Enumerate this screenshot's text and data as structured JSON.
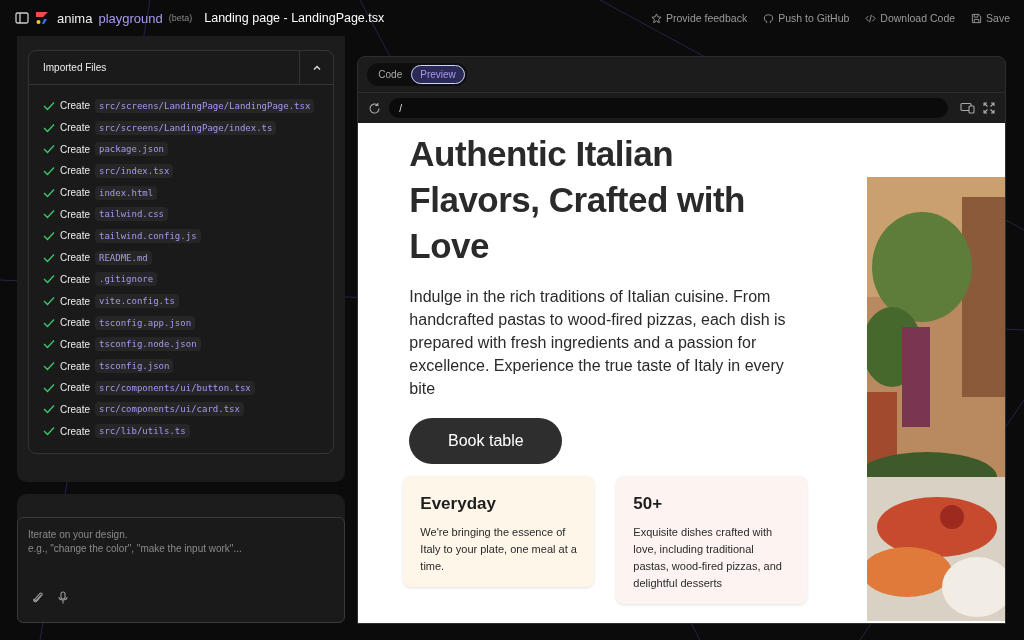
{
  "topbar": {
    "brand": "anima",
    "product": "playground",
    "badge": "(beta)",
    "title": "Landing page - LandingPage.tsx",
    "actions": [
      "Provide feedback",
      "Push to GitHub",
      "Download Code",
      "Save"
    ]
  },
  "imported_files": {
    "title": "Imported Files",
    "expanded": true,
    "items": [
      {
        "action": "Create",
        "path": "src/screens/LandingPage/LandingPage.tsx",
        "done": true
      },
      {
        "action": "Create",
        "path": "src/screens/LandingPage/index.ts",
        "done": true
      },
      {
        "action": "Create",
        "path": "package.json",
        "done": true
      },
      {
        "action": "Create",
        "path": "src/index.tsx",
        "done": true
      },
      {
        "action": "Create",
        "path": "index.html",
        "done": true
      },
      {
        "action": "Create",
        "path": "tailwind.css",
        "done": true
      },
      {
        "action": "Create",
        "path": "tailwind.config.js",
        "done": true
      },
      {
        "action": "Create",
        "path": "README.md",
        "done": true
      },
      {
        "action": "Create",
        "path": ".gitignore",
        "done": true
      },
      {
        "action": "Create",
        "path": "vite.config.ts",
        "done": true
      },
      {
        "action": "Create",
        "path": "tsconfig.app.json",
        "done": true
      },
      {
        "action": "Create",
        "path": "tsconfig.node.json",
        "done": true
      },
      {
        "action": "Create",
        "path": "tsconfig.json",
        "done": true
      },
      {
        "action": "Create",
        "path": "src/components/ui/button.tsx",
        "done": true
      },
      {
        "action": "Create",
        "path": "src/components/ui/card.tsx",
        "done": true
      },
      {
        "action": "Create",
        "path": "src/lib/utils.ts",
        "done": true
      }
    ]
  },
  "prompt": {
    "placeholder": "Iterate on your design.\ne.g., \"change the color\", \"make the input work\"..."
  },
  "preview": {
    "tabs": [
      {
        "label": "Code",
        "selected": false
      },
      {
        "label": "Preview",
        "selected": true
      }
    ],
    "url": "/",
    "page": {
      "headline": "Authentic Italian Flavors, Crafted with Love",
      "intro": "Indulge in the rich traditions of Italian cuisine. From handcrafted pastas to wood-fired pizzas, each dish is prepared with fresh ingredients and a passion for excellence. Experience the true taste of Italy in every bite",
      "button": "Book table",
      "cards": [
        {
          "title": "Everyday",
          "text": "We're bringing the essence of Italy to your plate, one meal at a time.",
          "color": "#fdf6e9"
        },
        {
          "title": "50+",
          "text": "Exquisite dishes crafted with love, including traditional pastas, wood-fired pizzas, and delightful desserts",
          "color": "#fdf4f2"
        }
      ]
    }
  }
}
